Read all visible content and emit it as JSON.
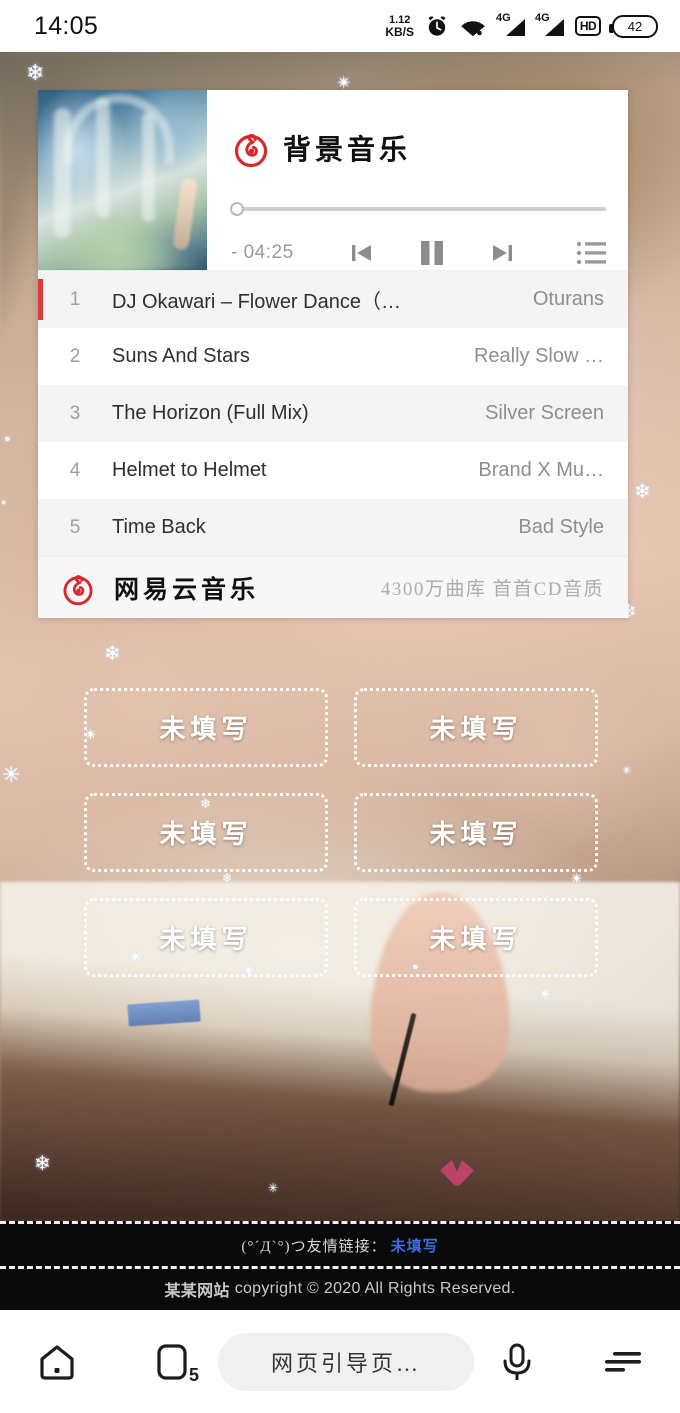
{
  "statusbar": {
    "time": "14:05",
    "netspeed_value": "1.12",
    "netspeed_unit": "KB/S",
    "alarm_icon": "alarm-clock-icon",
    "wifi_icon": "wifi-icon",
    "signal1_label": "4G",
    "signal2_label": "4G",
    "hd_label": "HD",
    "battery_level": "42"
  },
  "music_widget": {
    "logo_icon": "netease-cloud-music-logo",
    "title": "背景音乐",
    "cover_alt": "album-cover-art",
    "progress_percent": 0,
    "time_remaining": "- 04:25",
    "controls": {
      "prev_label": "prev-track",
      "play_state": "pause",
      "next_label": "next-track",
      "playlist_label": "playlist"
    },
    "playlist": [
      {
        "index": "1",
        "name": "DJ Okawari – Flower Dance（…",
        "artist": "Oturans",
        "active": true
      },
      {
        "index": "2",
        "name": "Suns And Stars",
        "artist": "Really Slow …",
        "active": false
      },
      {
        "index": "3",
        "name": "The Horizon (Full Mix)",
        "artist": "Silver Screen",
        "active": false
      },
      {
        "index": "4",
        "name": "Helmet to Helmet",
        "artist": "Brand X Mu…",
        "active": false
      },
      {
        "index": "5",
        "name": "Time Back",
        "artist": "Bad Style",
        "active": false
      }
    ],
    "footer": {
      "logo_icon": "netease-cloud-music-logo",
      "brand": "网易云音乐",
      "slogan": "4300万曲库 首首CD音质"
    }
  },
  "grid_cells": [
    {
      "label": "未填写"
    },
    {
      "label": "未填写"
    },
    {
      "label": "未填写"
    },
    {
      "label": "未填写"
    },
    {
      "label": "未填写"
    },
    {
      "label": "未填写"
    }
  ],
  "page_footer": {
    "links_prefix": "(°´Д`°)つ友情链接：",
    "links_value": "未填写",
    "copyright_cn": "某某网站",
    "copyright_en": "copyright © 2020 All Rights Reserved."
  },
  "browser_nav": {
    "home_icon": "home-icon",
    "tabs_icon": "tabs-icon",
    "tabs_count": "5",
    "url_text": "网页引导页…",
    "mic_icon": "microphone-icon",
    "menu_icon": "menu-icon"
  },
  "colors": {
    "accent_red": "#e03a3a",
    "link_blue": "#3d6ee0",
    "footer_bg": "#0a0a0a"
  }
}
